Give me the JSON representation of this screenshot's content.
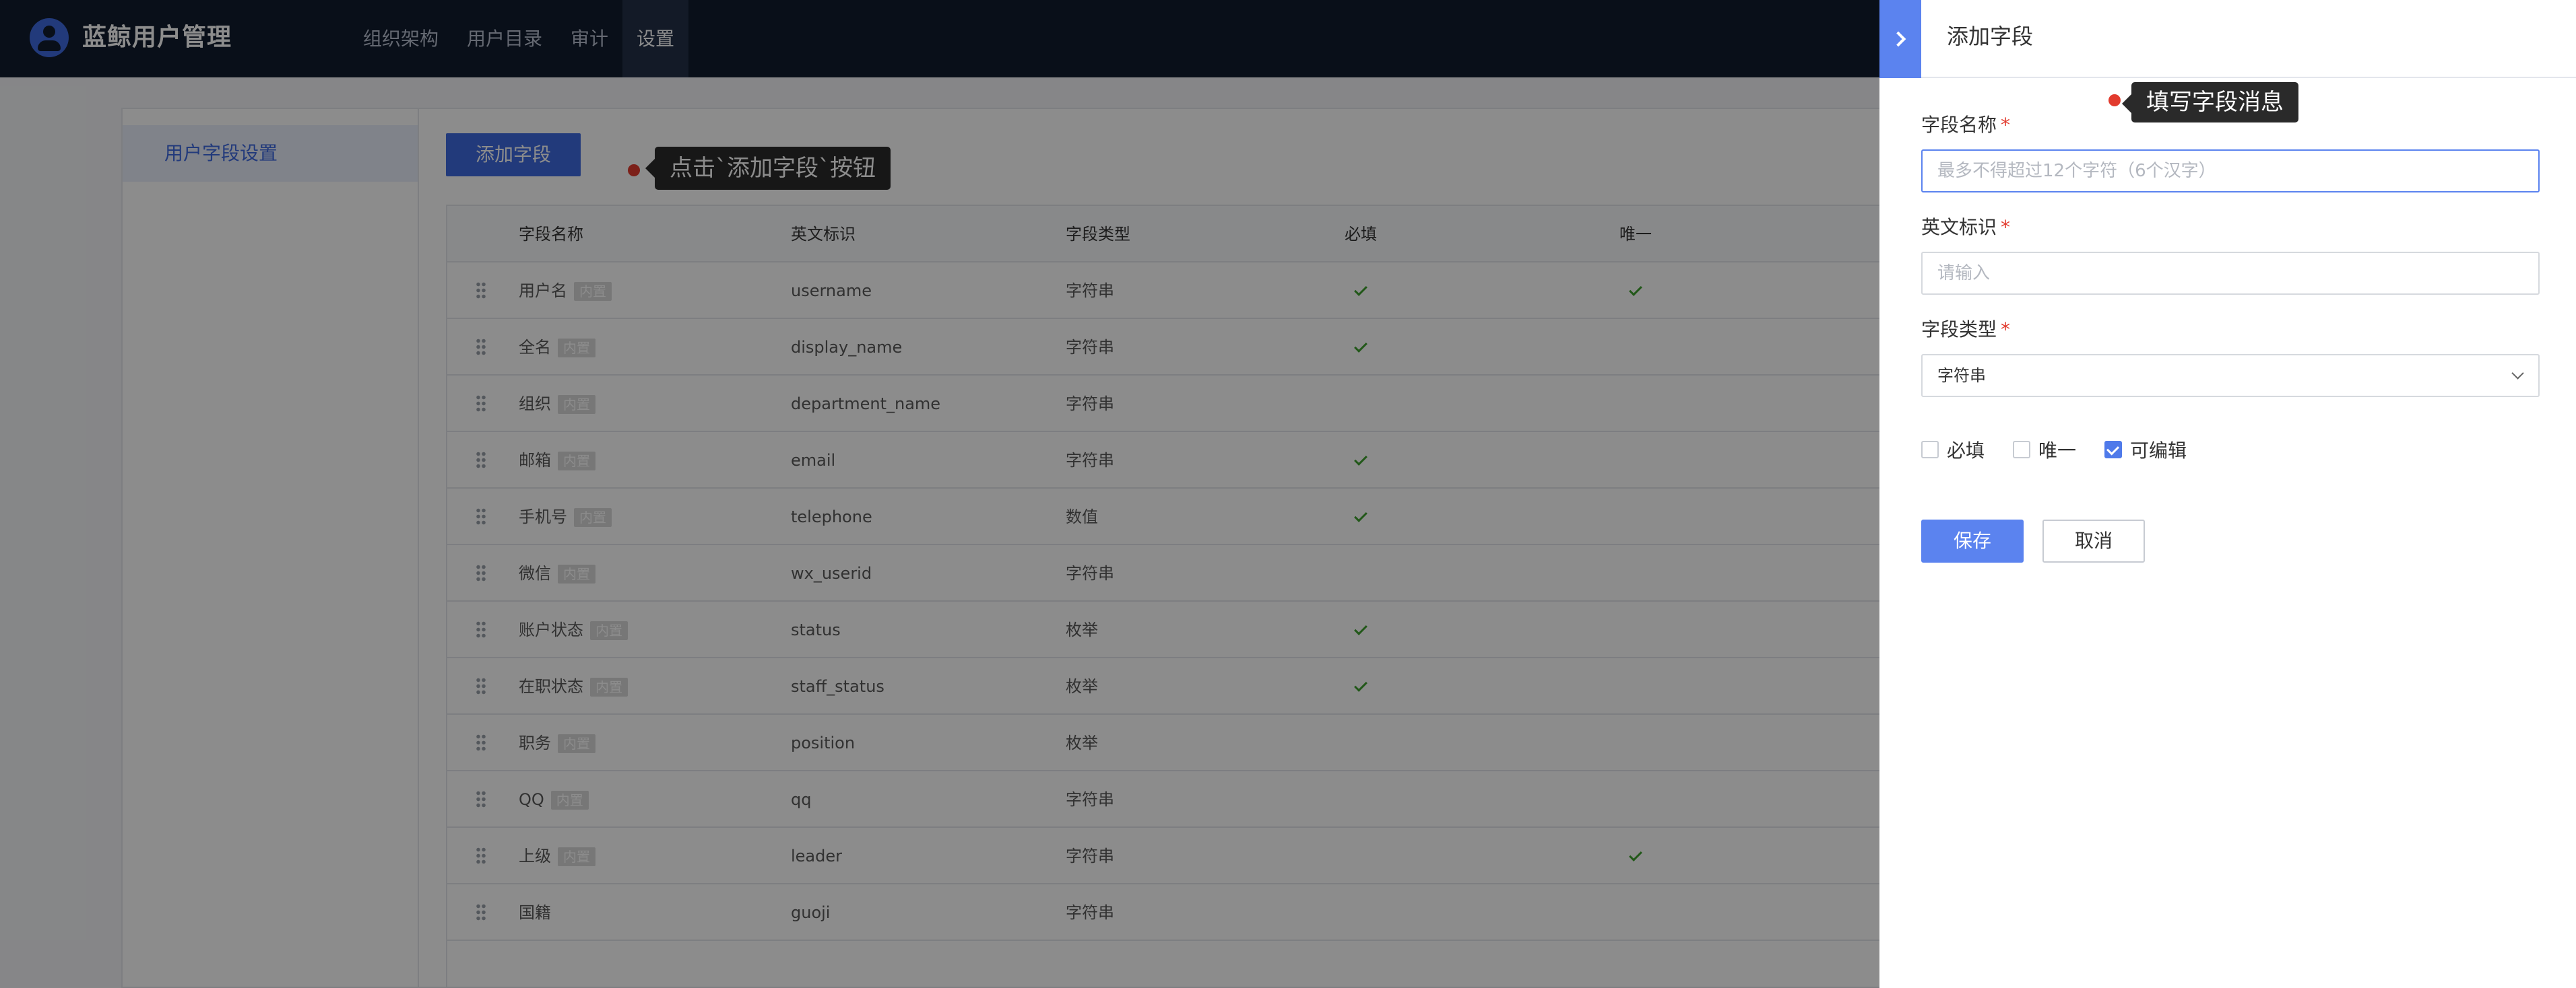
{
  "header": {
    "brand": "蓝鲸用户管理",
    "nav": [
      "组织架构",
      "用户目录",
      "审计",
      "设置"
    ],
    "active_nav": "设置"
  },
  "sidebar": {
    "item": "用户字段设置"
  },
  "toolbar": {
    "add_label": "添加字段"
  },
  "hints": {
    "add_button": "点击`添加字段`按钮",
    "fill_form": "填写字段消息"
  },
  "table": {
    "columns": [
      "字段名称",
      "英文标识",
      "字段类型",
      "必填",
      "唯一"
    ],
    "builtin_badge": "内置",
    "rows": [
      {
        "name": "用户名",
        "builtin": true,
        "key": "username",
        "type": "字符串",
        "required": true,
        "unique": true
      },
      {
        "name": "全名",
        "builtin": true,
        "key": "display_name",
        "type": "字符串",
        "required": true,
        "unique": false
      },
      {
        "name": "组织",
        "builtin": true,
        "key": "department_name",
        "type": "字符串",
        "required": false,
        "unique": false
      },
      {
        "name": "邮箱",
        "builtin": true,
        "key": "email",
        "type": "字符串",
        "required": true,
        "unique": false
      },
      {
        "name": "手机号",
        "builtin": true,
        "key": "telephone",
        "type": "数值",
        "required": true,
        "unique": false
      },
      {
        "name": "微信",
        "builtin": true,
        "key": "wx_userid",
        "type": "字符串",
        "required": false,
        "unique": false
      },
      {
        "name": "账户状态",
        "builtin": true,
        "key": "status",
        "type": "枚举",
        "required": true,
        "unique": false
      },
      {
        "name": "在职状态",
        "builtin": true,
        "key": "staff_status",
        "type": "枚举",
        "required": true,
        "unique": false
      },
      {
        "name": "职务",
        "builtin": true,
        "key": "position",
        "type": "枚举",
        "required": false,
        "unique": false
      },
      {
        "name": "QQ",
        "builtin": true,
        "key": "qq",
        "type": "字符串",
        "required": false,
        "unique": false
      },
      {
        "name": "上级",
        "builtin": true,
        "key": "leader",
        "type": "字符串",
        "required": false,
        "unique": true
      },
      {
        "name": "国籍",
        "builtin": false,
        "key": "guoji",
        "type": "字符串",
        "required": false,
        "unique": false
      }
    ]
  },
  "drawer": {
    "title": "添加字段",
    "required_mark": "*",
    "name_label": "字段名称",
    "name_placeholder": "最多不得超过12个字符（6个汉字）",
    "key_label": "英文标识",
    "key_placeholder": "请输入",
    "type_label": "字段类型",
    "type_value": "字符串",
    "options": [
      {
        "label": "必填",
        "checked": false
      },
      {
        "label": "唯一",
        "checked": false
      },
      {
        "label": "可编辑",
        "checked": true
      }
    ],
    "save_label": "保存",
    "cancel_label": "取消"
  },
  "colors": {
    "header_bg": "#121c2e",
    "primary": "#3f6ae0",
    "drawer_primary": "#5b83ef",
    "check_green": "#3fa12f",
    "hint_dot": "#e23b2e"
  }
}
